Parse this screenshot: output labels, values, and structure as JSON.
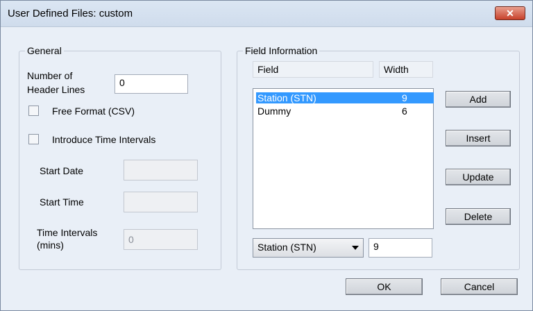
{
  "window": {
    "title": "User Defined Files: custom",
    "close_label": "✕"
  },
  "general": {
    "legend": "General",
    "header_lines_label_1": "Number of",
    "header_lines_label_2": "Header Lines",
    "header_lines_value": "0",
    "free_format_label": "Free Format (CSV)",
    "free_format_checked": false,
    "time_intervals_label": "Introduce Time Intervals",
    "time_intervals_checked": false,
    "start_date_label": "Start Date",
    "start_date_value": "",
    "start_time_label": "Start Time",
    "start_time_value": "",
    "interval_label_1": "Time Intervals",
    "interval_label_2": "(mins)",
    "interval_value": "0"
  },
  "field_info": {
    "legend": "Field Information",
    "col_field": "Field",
    "col_width": "Width",
    "rows": [
      {
        "field": "Station (STN)",
        "width": "9",
        "selected": true
      },
      {
        "field": "Dummy",
        "width": "6",
        "selected": false
      }
    ],
    "combo_value": "Station (STN)",
    "width_value": "9",
    "buttons": {
      "add": "Add",
      "insert": "Insert",
      "update": "Update",
      "delete": "Delete"
    }
  },
  "footer": {
    "ok": "OK",
    "cancel": "Cancel"
  }
}
